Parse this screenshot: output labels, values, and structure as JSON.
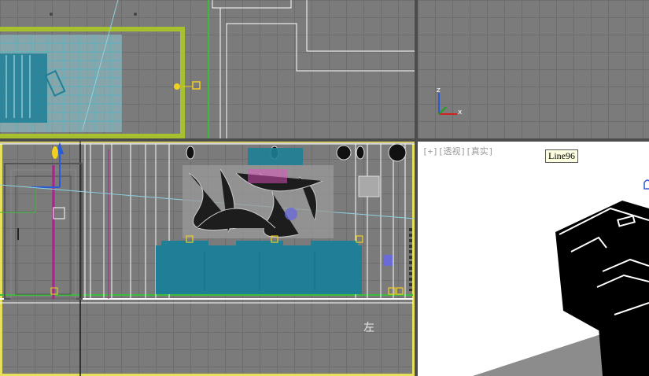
{
  "viewports": {
    "top_left": {
      "label": "",
      "active": false
    },
    "top_right": {
      "label": ""
    },
    "bottom_left": {
      "label": "",
      "active": true
    },
    "bottom_right": {
      "label": "[+][透视][真实]"
    }
  },
  "top_left_axis": {
    "z_label": "z",
    "x_label": "x"
  },
  "wall_label": "左",
  "tooltip": {
    "text": "Line96"
  },
  "colors": {
    "grid_bg": "#7b7b7b",
    "active_border": "#e6e05a",
    "furniture_teal": "#1e7f96",
    "perspective_bg": "#ffffff",
    "wire_white": "#ffffff",
    "green_wall": "#a7c02e"
  }
}
